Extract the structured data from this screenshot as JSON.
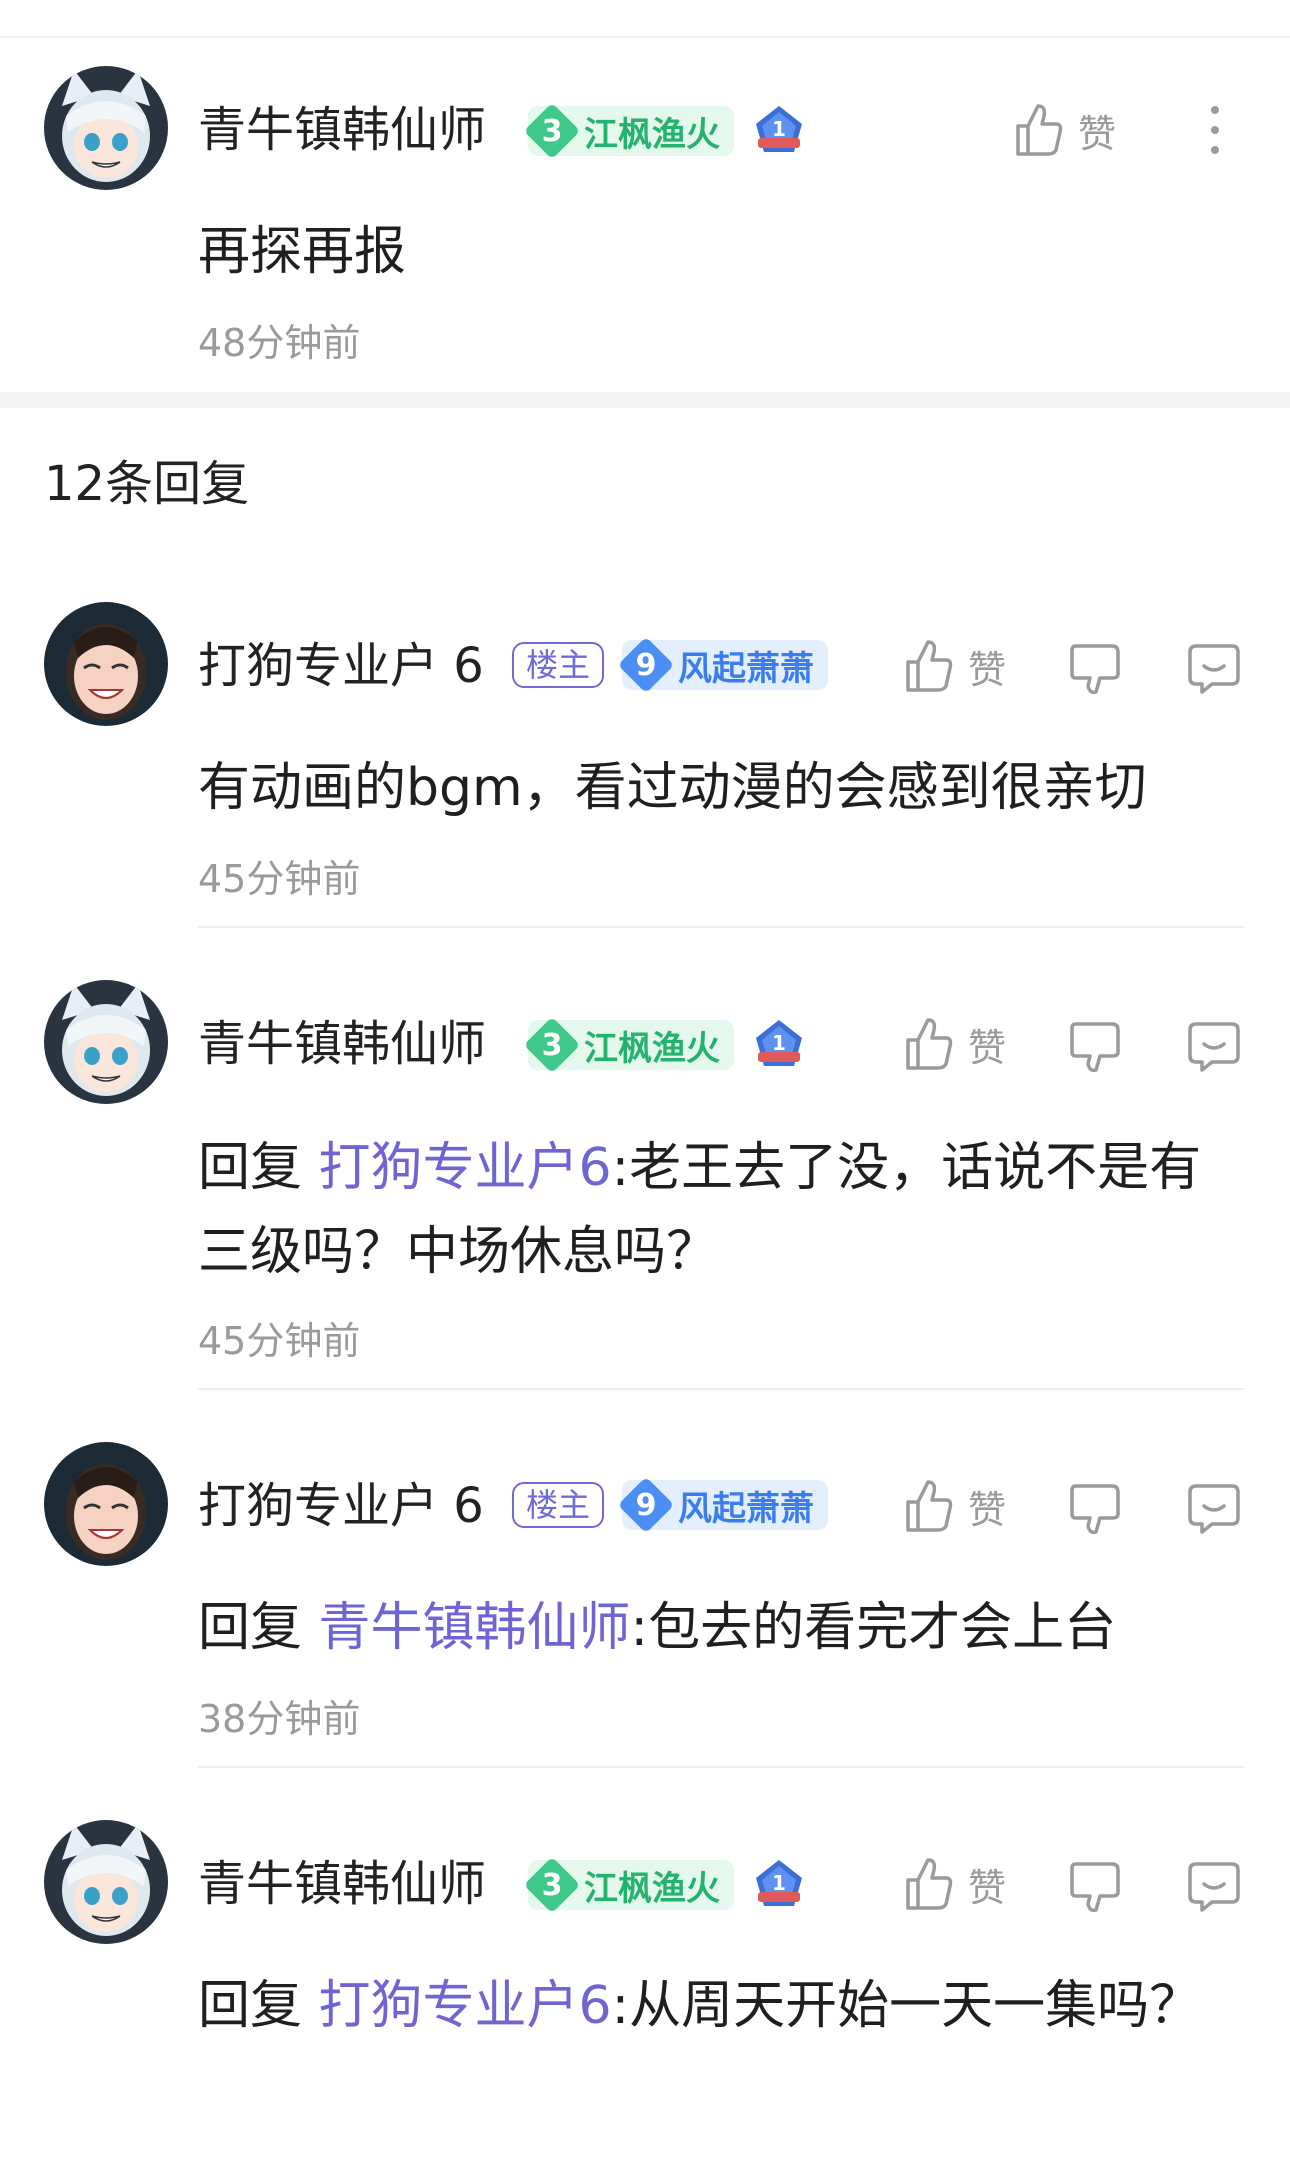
{
  "main_comment": {
    "author": "青牛镇韩仙师",
    "level_num": "3",
    "level_name": "江枫渔火",
    "medal_num": "1",
    "like_label": "赞",
    "content": "再探再报",
    "time": "48分钟前",
    "avatar_icon": "anime-cat-avatar"
  },
  "replies_header": {
    "count_label": "12条回复"
  },
  "replies": [
    {
      "author": "打狗专业户 6",
      "owner_tag": "楼主",
      "level_num": "9",
      "level_name": "风起萧萧",
      "like_label": "赞",
      "reply_prefix": "",
      "mention": "",
      "content": "有动画的bgm，看过动漫的会感到很亲切",
      "time": "45分钟前"
    },
    {
      "author": "青牛镇韩仙师",
      "level_num": "3",
      "level_name": "江枫渔火",
      "medal_num": "1",
      "like_label": "赞",
      "reply_prefix": "回复 ",
      "mention": "打狗专业户6",
      "content": ":老王去了没，话说不是有三级吗？中场休息吗？",
      "time": "45分钟前"
    },
    {
      "author": "打狗专业户 6",
      "owner_tag": "楼主",
      "level_num": "9",
      "level_name": "风起萧萧",
      "like_label": "赞",
      "reply_prefix": "回复 ",
      "mention": "青牛镇韩仙师",
      "content": ":包去的看完才会上台",
      "time": "38分钟前"
    },
    {
      "author": "青牛镇韩仙师",
      "level_num": "3",
      "level_name": "江枫渔火",
      "medal_num": "1",
      "like_label": "赞",
      "reply_prefix": "回复 ",
      "mention": "打狗专业户6",
      "content": ":从周天开始一天一集吗？",
      "time": ""
    }
  ],
  "colors": {
    "mention": "#6e64d4",
    "green_level": "#3ec88a",
    "blue_level": "#4b8ff5",
    "muted": "#9a9a9a"
  }
}
